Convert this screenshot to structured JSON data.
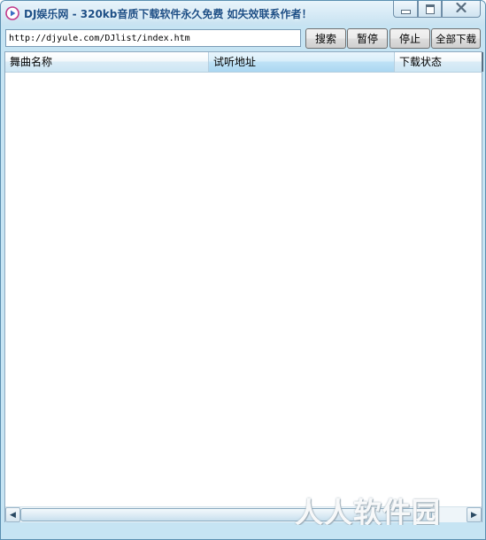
{
  "window": {
    "title": "DJ娱乐网 - 320kb音质下载软件永久免费 如失效联系作者！",
    "app_icon": "play-circle-icon",
    "controls": [
      "minimize-icon",
      "maximize-icon",
      "close-icon"
    ]
  },
  "toolbar": {
    "url_value": "http://djyule.com/DJlist/index.htm",
    "search_label": "搜索",
    "pause_label": "暂停",
    "stop_label": "停止",
    "download_all_label": "全部下载"
  },
  "list": {
    "columns": [
      "舞曲名称",
      "试听地址",
      "下载状态"
    ],
    "rows": []
  },
  "watermark": "人人软件园",
  "colors": {
    "title_text": "#1d4f86",
    "frame": "#c6e4f3",
    "close_button": "#c4473b",
    "sorted_column": "#bfe2f6"
  }
}
